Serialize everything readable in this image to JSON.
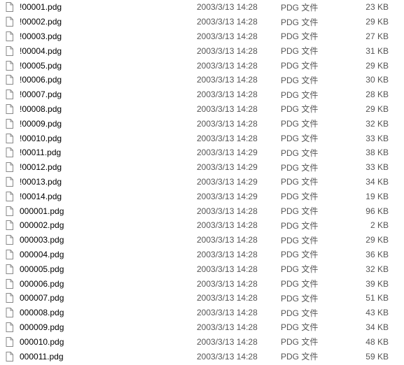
{
  "files": [
    {
      "name": "!00001.pdg",
      "date": "2003/3/13 14:28",
      "type": "PDG 文件",
      "size": "23 KB"
    },
    {
      "name": "!00002.pdg",
      "date": "2003/3/13 14:28",
      "type": "PDG 文件",
      "size": "29 KB"
    },
    {
      "name": "!00003.pdg",
      "date": "2003/3/13 14:28",
      "type": "PDG 文件",
      "size": "27 KB"
    },
    {
      "name": "!00004.pdg",
      "date": "2003/3/13 14:28",
      "type": "PDG 文件",
      "size": "31 KB"
    },
    {
      "name": "!00005.pdg",
      "date": "2003/3/13 14:28",
      "type": "PDG 文件",
      "size": "29 KB"
    },
    {
      "name": "!00006.pdg",
      "date": "2003/3/13 14:28",
      "type": "PDG 文件",
      "size": "30 KB"
    },
    {
      "name": "!00007.pdg",
      "date": "2003/3/13 14:28",
      "type": "PDG 文件",
      "size": "28 KB"
    },
    {
      "name": "!00008.pdg",
      "date": "2003/3/13 14:28",
      "type": "PDG 文件",
      "size": "29 KB"
    },
    {
      "name": "!00009.pdg",
      "date": "2003/3/13 14:28",
      "type": "PDG 文件",
      "size": "32 KB"
    },
    {
      "name": "!00010.pdg",
      "date": "2003/3/13 14:28",
      "type": "PDG 文件",
      "size": "33 KB"
    },
    {
      "name": "!00011.pdg",
      "date": "2003/3/13 14:29",
      "type": "PDG 文件",
      "size": "38 KB"
    },
    {
      "name": "!00012.pdg",
      "date": "2003/3/13 14:29",
      "type": "PDG 文件",
      "size": "33 KB"
    },
    {
      "name": "!00013.pdg",
      "date": "2003/3/13 14:29",
      "type": "PDG 文件",
      "size": "34 KB"
    },
    {
      "name": "!00014.pdg",
      "date": "2003/3/13 14:29",
      "type": "PDG 文件",
      "size": "19 KB"
    },
    {
      "name": "000001.pdg",
      "date": "2003/3/13 14:28",
      "type": "PDG 文件",
      "size": "96 KB"
    },
    {
      "name": "000002.pdg",
      "date": "2003/3/13 14:28",
      "type": "PDG 文件",
      "size": "2 KB"
    },
    {
      "name": "000003.pdg",
      "date": "2003/3/13 14:28",
      "type": "PDG 文件",
      "size": "29 KB"
    },
    {
      "name": "000004.pdg",
      "date": "2003/3/13 14:28",
      "type": "PDG 文件",
      "size": "36 KB"
    },
    {
      "name": "000005.pdg",
      "date": "2003/3/13 14:28",
      "type": "PDG 文件",
      "size": "32 KB"
    },
    {
      "name": "000006.pdg",
      "date": "2003/3/13 14:28",
      "type": "PDG 文件",
      "size": "39 KB"
    },
    {
      "name": "000007.pdg",
      "date": "2003/3/13 14:28",
      "type": "PDG 文件",
      "size": "51 KB"
    },
    {
      "name": "000008.pdg",
      "date": "2003/3/13 14:28",
      "type": "PDG 文件",
      "size": "43 KB"
    },
    {
      "name": "000009.pdg",
      "date": "2003/3/13 14:28",
      "type": "PDG 文件",
      "size": "34 KB"
    },
    {
      "name": "000010.pdg",
      "date": "2003/3/13 14:28",
      "type": "PDG 文件",
      "size": "48 KB"
    },
    {
      "name": "000011.pdg",
      "date": "2003/3/13 14:28",
      "type": "PDG 文件",
      "size": "59 KB"
    }
  ]
}
